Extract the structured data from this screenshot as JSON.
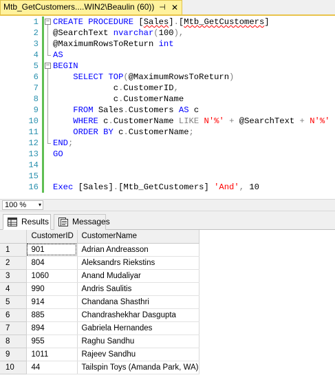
{
  "window": {
    "tab_title": "Mtb_GetCustomers....WIN2\\Beaulin (60))",
    "pin_glyph": "⊣",
    "close_glyph": "✕"
  },
  "editor": {
    "lines": [
      {
        "n": "1",
        "html": "<span class=\"kw\">CREATE PROCEDURE</span> <span class=\"tx\">[<span class=\"squiggle\">Sales</span>]</span><span class=\"gr\">.</span><span class=\"tx\">[<span class=\"squiggle\">Mtb_GetCustomers</span>]</span>"
      },
      {
        "n": "2",
        "html": "<span class=\"tx\">@SearchText</span> <span class=\"ty\">nvarchar</span><span class=\"gr\">(</span><span class=\"tx\">100</span><span class=\"gr\">),</span>"
      },
      {
        "n": "3",
        "html": "<span class=\"tx\">@MaximumRowsToReturn</span> <span class=\"ty\">int</span>"
      },
      {
        "n": "4",
        "html": "<span class=\"kw\">AS</span>"
      },
      {
        "n": "5",
        "html": "<span class=\"kw\">BEGIN</span>"
      },
      {
        "n": "6",
        "html": "    <span class=\"kw\">SELECT TOP</span><span class=\"gr\">(</span><span class=\"tx\">@MaximumRowsToReturn</span><span class=\"gr\">)</span>"
      },
      {
        "n": "7",
        "html": "            <span class=\"tx\">c</span><span class=\"gr\">.</span><span class=\"tx\">CustomerID</span><span class=\"gr\">,</span>"
      },
      {
        "n": "8",
        "html": "            <span class=\"tx\">c</span><span class=\"gr\">.</span><span class=\"tx\">CustomerName</span>"
      },
      {
        "n": "9",
        "html": "    <span class=\"kw\">FROM</span> <span class=\"tx\">Sales</span><span class=\"gr\">.</span><span class=\"tx\">Customers</span> <span class=\"kw\">AS</span> <span class=\"tx\">c</span>"
      },
      {
        "n": "10",
        "html": "    <span class=\"kw\">WHERE</span> <span class=\"tx\">c</span><span class=\"gr\">.</span><span class=\"tx\">CustomerName</span> <span class=\"gr\">LIKE</span> <span class=\"str\">N'%'</span> <span class=\"gr\">+</span> <span class=\"tx\">@SearchText</span> <span class=\"gr\">+</span> <span class=\"str\">N'%'</span>"
      },
      {
        "n": "11",
        "html": "    <span class=\"kw\">ORDER BY</span> <span class=\"tx\">c</span><span class=\"gr\">.</span><span class=\"tx\">CustomerName</span><span class=\"gr\">;</span>"
      },
      {
        "n": "12",
        "html": "<span class=\"kw\">END</span><span class=\"gr\">;</span>"
      },
      {
        "n": "13",
        "html": "<span class=\"kw\">GO</span>"
      },
      {
        "n": "14",
        "html": ""
      },
      {
        "n": "15",
        "html": ""
      },
      {
        "n": "16",
        "html": "<span class=\"kw\">Exec</span> <span class=\"tx\">[Sales]</span><span class=\"gr\">.</span><span class=\"tx\">[Mtb_GetCustomers]</span> <span class=\"str\">'And'</span><span class=\"gr\">,</span> <span class=\"tx\">10</span>"
      }
    ],
    "fold_open": "−",
    "accent": "#5fbe53"
  },
  "zoom": {
    "value": "100 %",
    "arrow": "▾"
  },
  "results": {
    "tabs": [
      {
        "label": "Results",
        "icon": "grid-icon"
      },
      {
        "label": "Messages",
        "icon": "messages-icon"
      }
    ],
    "columns": [
      "",
      "CustomerID",
      "CustomerName"
    ],
    "rows": [
      [
        "1",
        "901",
        "Adrian Andreasson"
      ],
      [
        "2",
        "804",
        "Aleksandrs Riekstins"
      ],
      [
        "3",
        "1060",
        "Anand Mudaliyar"
      ],
      [
        "4",
        "990",
        "Andris Saulitis"
      ],
      [
        "5",
        "914",
        "Chandana Shasthri"
      ],
      [
        "6",
        "885",
        "Chandrashekhar Dasgupta"
      ],
      [
        "7",
        "894",
        "Gabriela Hernandes"
      ],
      [
        "8",
        "955",
        "Raghu Sandhu"
      ],
      [
        "9",
        "1011",
        "Rajeev Sandhu"
      ],
      [
        "10",
        "44",
        "Tailspin Toys (Amanda Park, WA)"
      ]
    ]
  }
}
